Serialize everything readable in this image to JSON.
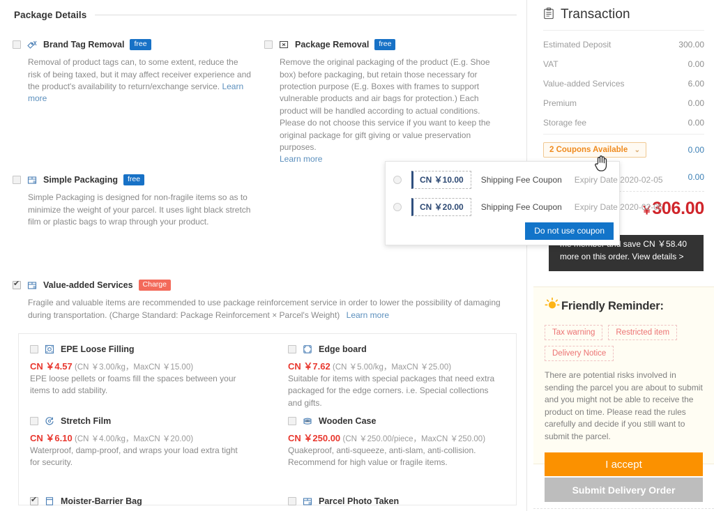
{
  "left": {
    "section_title": "Package Details",
    "options": [
      {
        "id": "brand-tag-removal",
        "label": "Brand Tag Removal",
        "badge": "free",
        "badge_type": "free",
        "checked": false,
        "icon": "tag-slash-icon",
        "desc": "Removal of product tags can, to some extent, reduce the risk of being taxed, but it may affect receiver experience and the product's availability to return/exchange service.",
        "learn_more": "Learn more"
      },
      {
        "id": "package-removal",
        "label": "Package Removal",
        "badge": "free",
        "badge_type": "free",
        "checked": false,
        "icon": "box-x-icon",
        "desc": "Remove the original packaging of the product (E.g. Shoe box) before packaging, but retain those necessary for protection purpose (E.g. Boxes with frames to support vulnerable products and air bags for protection.) Each product will be handled according to actual conditions. Please do not choose this service if you want to keep the original package for gift giving or value preservation purposes.",
        "learn_more": "Learn more"
      },
      {
        "id": "simple-packaging",
        "label": "Simple Packaging",
        "badge": "free",
        "badge_type": "free",
        "checked": false,
        "icon": "package-icon",
        "desc": "Simple Packaging is designed for non-fragile items so as to minimize the weight of your parcel. It uses light black stretch film or plastic bags to wrap through your product.",
        "learn_more": ""
      },
      {
        "id": "value-added-services",
        "label": "Value-added Services",
        "badge": "Charge",
        "badge_type": "charge",
        "checked": true,
        "icon": "package-icon",
        "desc": "Fragile and valuable items are recommended to use package reinforcement service in order to lower the possibility of damaging during transportation. (Charge Standard: Package Reinforcement × Parcel's Weight)",
        "learn_more": "Learn more"
      }
    ],
    "vas_items": [
      {
        "id": "epe-loose-filling",
        "label": "EPE Loose Filling",
        "icon": "epe-loose-filling-icon",
        "checked": false,
        "price": "CN ￥4.57",
        "price_note": "(CN ￥3.00/kg，MaxCN ￥15.00)",
        "desc": "EPE loose pellets or foams fill the spaces between your items to add stability."
      },
      {
        "id": "edge-board",
        "label": "Edge board",
        "icon": "edge-board-icon",
        "checked": false,
        "price": "CN ￥7.62",
        "price_note": "(CN ￥5.00/kg，MaxCN ￥25.00)",
        "desc": "Suitable for items with special packages that need extra packaged for the edge corners. i.e. Special collections and gifts."
      },
      {
        "id": "stretch-film",
        "label": "Stretch Film",
        "icon": "stretch-film-icon",
        "checked": false,
        "price": "CN ￥6.10",
        "price_note": "(CN ￥4.00/kg，MaxCN ￥20.00)",
        "desc": "Waterproof, damp-proof, and wraps your load extra tight for security."
      },
      {
        "id": "wooden-case",
        "label": "Wooden Case",
        "icon": "wooden-case-icon",
        "checked": false,
        "price": "CN ￥250.00",
        "price_note": "(CN ￥250.00/piece，MaxCN ￥250.00)",
        "desc": "Quakeproof, anti-squeeze, anti-slam, anti-collision. Recommend for high value or fragile items."
      },
      {
        "id": "moister-barrier-bag",
        "label": "Moister-Barrier Bag",
        "icon": "moister-barrier-bag-icon",
        "checked": true,
        "price": "",
        "price_note": "",
        "desc": ""
      },
      {
        "id": "parcel-photo-taken",
        "label": "Parcel Photo Taken",
        "icon": "parcel-photo-icon",
        "checked": false,
        "price": "",
        "price_note": "",
        "desc": ""
      }
    ]
  },
  "transaction": {
    "title": "Transaction",
    "icon": "clipboard-icon",
    "rows": [
      {
        "label": "Estimated Deposit",
        "value": "300.00"
      },
      {
        "label": "VAT",
        "value": "0.00"
      },
      {
        "label": "Value-added Services",
        "value": "6.00"
      },
      {
        "label": "Premium",
        "value": "0.00"
      },
      {
        "label": "Storage fee",
        "value": "0.00"
      }
    ],
    "coupon_button": "2 Coupons Available",
    "coupon_caret": "⌄",
    "coupon_value": "0.00",
    "second_value": "0.00",
    "total_currency": "￥",
    "total_amount": "306.00",
    "tooltip": "me member and save CN ￥58.40 more on this order. View details >"
  },
  "coupon_popup": {
    "coupons": [
      {
        "amount": "CN ￥10.00",
        "name": "Shipping Fee Coupon",
        "expiry": "Expiry Date 2020-02-05",
        "selected": false
      },
      {
        "amount": "CN ￥20.00",
        "name": "Shipping Fee Coupon",
        "expiry": "Expiry Date 2020-02-05",
        "selected": false
      }
    ],
    "action_label": "Do not use coupon"
  },
  "reminder": {
    "icon": "lightbulb-icon",
    "title": "Friendly Reminder:",
    "chips": [
      "Tax warning",
      "Restricted item",
      "Delivery Notice"
    ],
    "text": "There are potential risks involved in sending the parcel you are about to submit and you might not be able to receive the product on time. Please read the rules carefully and decide if you still want to submit the parcel.",
    "accept_label": "I accept",
    "submit_label": "Submit Delivery Order"
  },
  "colors": {
    "accent_orange": "#fb9100",
    "price_red": "#e8382f",
    "total_red": "#d0252b",
    "link_blue": "#5b8fbd",
    "badge_free": "#1771c6",
    "badge_charge": "#f36a5a",
    "coupon_border": "#f0c892",
    "button_blue": "#1274c9"
  }
}
